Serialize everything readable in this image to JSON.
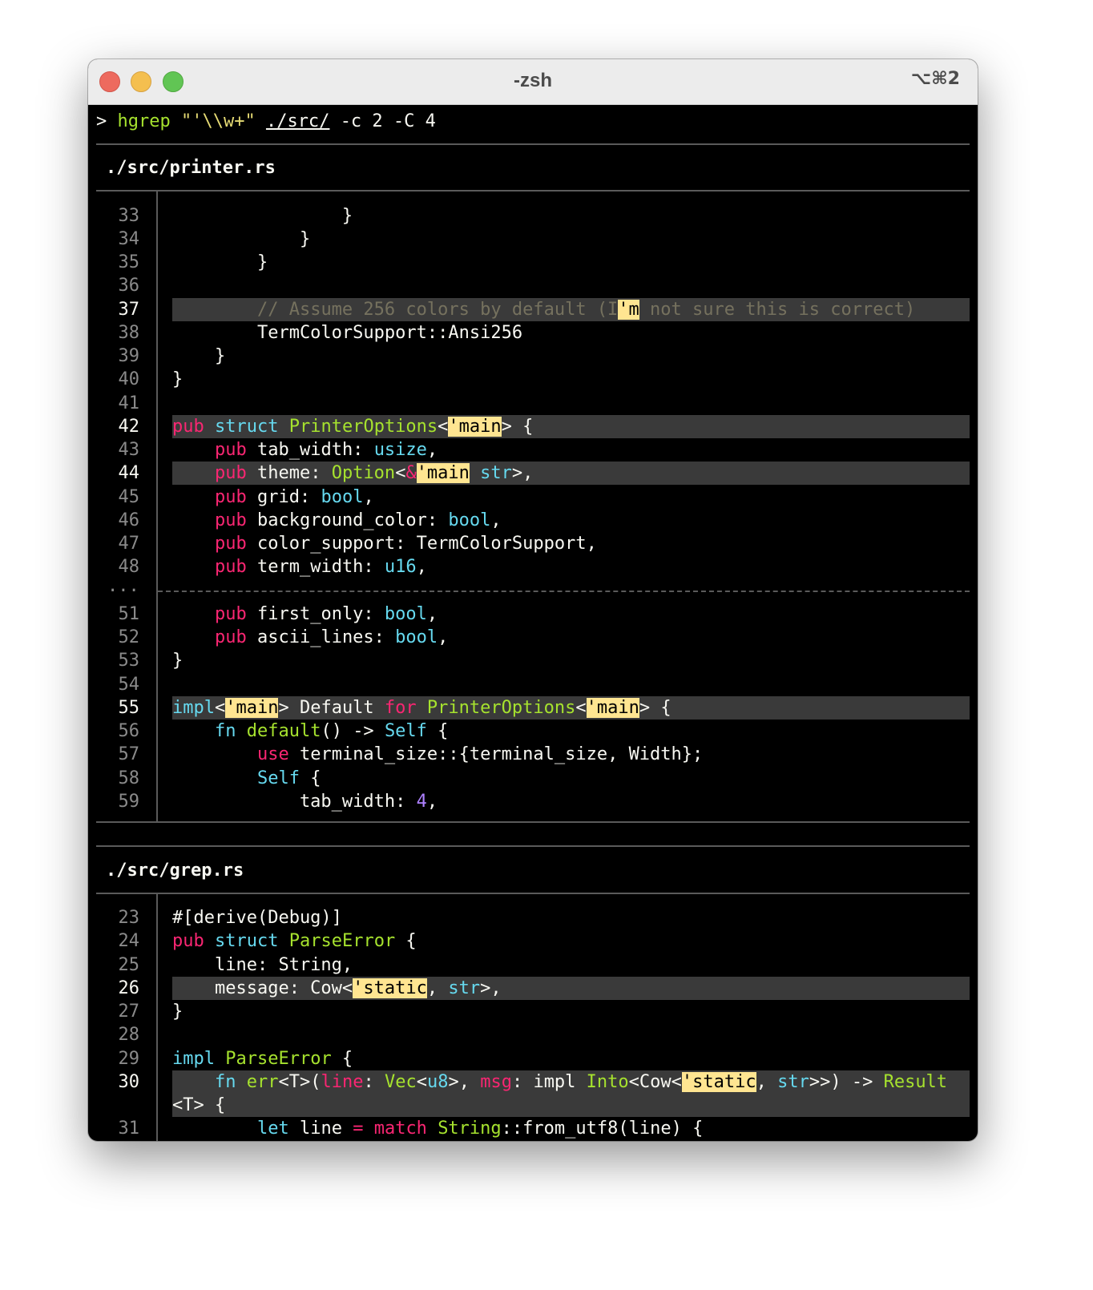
{
  "window": {
    "title": "-zsh",
    "shortcut": "⌥⌘2"
  },
  "command": {
    "prompt": ">",
    "program": "hgrep",
    "pattern": "\"'\\\\w+\"",
    "path": "./src/",
    "flags": "-c 2 -C 4"
  },
  "files": [
    {
      "name": "./src/printer.rs",
      "lines": [
        {
          "num": "33",
          "match": false,
          "tokens": [
            [
              "t",
              "                }"
            ]
          ]
        },
        {
          "num": "34",
          "match": false,
          "tokens": [
            [
              "t",
              "            }"
            ]
          ]
        },
        {
          "num": "35",
          "match": false,
          "tokens": [
            [
              "t",
              "        }"
            ]
          ]
        },
        {
          "num": "36",
          "match": false,
          "tokens": []
        },
        {
          "num": "37",
          "match": true,
          "tokens": [
            [
              "t",
              "        "
            ],
            [
              "cm",
              "// Assume 256 colors by default (I"
            ],
            [
              "mh",
              "'m"
            ],
            [
              "cm",
              " not sure this is correct)"
            ]
          ]
        },
        {
          "num": "38",
          "match": false,
          "tokens": [
            [
              "t",
              "        TermColorSupport::Ansi256"
            ]
          ]
        },
        {
          "num": "39",
          "match": false,
          "tokens": [
            [
              "t",
              "    }"
            ]
          ]
        },
        {
          "num": "40",
          "match": false,
          "tokens": [
            [
              "t",
              "}"
            ]
          ]
        },
        {
          "num": "41",
          "match": false,
          "tokens": []
        },
        {
          "num": "42",
          "match": true,
          "tokens": [
            [
              "kw",
              "pub"
            ],
            [
              "t",
              " "
            ],
            [
              "ty",
              "struct"
            ],
            [
              "t",
              " "
            ],
            [
              "fn",
              "PrinterOptions"
            ],
            [
              "t",
              "<"
            ],
            [
              "mh",
              "'main"
            ],
            [
              "t",
              "> {"
            ]
          ]
        },
        {
          "num": "43",
          "match": false,
          "tokens": [
            [
              "t",
              "    "
            ],
            [
              "kw",
              "pub"
            ],
            [
              "t",
              " tab_width: "
            ],
            [
              "ty",
              "usize"
            ],
            [
              "t",
              ","
            ]
          ]
        },
        {
          "num": "44",
          "match": true,
          "tokens": [
            [
              "t",
              "    "
            ],
            [
              "kw",
              "pub"
            ],
            [
              "t",
              " theme: "
            ],
            [
              "fn",
              "Option"
            ],
            [
              "t",
              "<"
            ],
            [
              "op",
              "&"
            ],
            [
              "mh",
              "'main"
            ],
            [
              "t",
              " "
            ],
            [
              "ty",
              "str"
            ],
            [
              "t",
              ">,"
            ]
          ]
        },
        {
          "num": "45",
          "match": false,
          "tokens": [
            [
              "t",
              "    "
            ],
            [
              "kw",
              "pub"
            ],
            [
              "t",
              " grid: "
            ],
            [
              "ty",
              "bool"
            ],
            [
              "t",
              ","
            ]
          ]
        },
        {
          "num": "46",
          "match": false,
          "tokens": [
            [
              "t",
              "    "
            ],
            [
              "kw",
              "pub"
            ],
            [
              "t",
              " background_color: "
            ],
            [
              "ty",
              "bool"
            ],
            [
              "t",
              ","
            ]
          ]
        },
        {
          "num": "47",
          "match": false,
          "tokens": [
            [
              "t",
              "    "
            ],
            [
              "kw",
              "pub"
            ],
            [
              "t",
              " color_support: TermColorSupport,"
            ]
          ]
        },
        {
          "num": "48",
          "match": false,
          "tokens": [
            [
              "t",
              "    "
            ],
            [
              "kw",
              "pub"
            ],
            [
              "t",
              " term_width: "
            ],
            [
              "ty",
              "u16"
            ],
            [
              "t",
              ","
            ]
          ]
        },
        {
          "elision": "..."
        },
        {
          "num": "51",
          "match": false,
          "tokens": [
            [
              "t",
              "    "
            ],
            [
              "kw",
              "pub"
            ],
            [
              "t",
              " first_only: "
            ],
            [
              "ty",
              "bool"
            ],
            [
              "t",
              ","
            ]
          ]
        },
        {
          "num": "52",
          "match": false,
          "tokens": [
            [
              "t",
              "    "
            ],
            [
              "kw",
              "pub"
            ],
            [
              "t",
              " ascii_lines: "
            ],
            [
              "ty",
              "bool"
            ],
            [
              "t",
              ","
            ]
          ]
        },
        {
          "num": "53",
          "match": false,
          "tokens": [
            [
              "t",
              "}"
            ]
          ]
        },
        {
          "num": "54",
          "match": false,
          "tokens": []
        },
        {
          "num": "55",
          "match": true,
          "tokens": [
            [
              "ty",
              "impl"
            ],
            [
              "t",
              "<"
            ],
            [
              "mh",
              "'main"
            ],
            [
              "t",
              "> Default "
            ],
            [
              "kw",
              "for"
            ],
            [
              "t",
              " "
            ],
            [
              "fn",
              "PrinterOptions"
            ],
            [
              "t",
              "<"
            ],
            [
              "mh",
              "'main"
            ],
            [
              "t",
              "> {"
            ]
          ]
        },
        {
          "num": "56",
          "match": false,
          "tokens": [
            [
              "t",
              "    "
            ],
            [
              "ty",
              "fn"
            ],
            [
              "t",
              " "
            ],
            [
              "fn",
              "default"
            ],
            [
              "t",
              "() -> "
            ],
            [
              "ty",
              "Self"
            ],
            [
              "t",
              " {"
            ]
          ]
        },
        {
          "num": "57",
          "match": false,
          "tokens": [
            [
              "t",
              "        "
            ],
            [
              "kw",
              "use"
            ],
            [
              "t",
              " terminal_size::{terminal_size, Width};"
            ]
          ]
        },
        {
          "num": "58",
          "match": false,
          "tokens": [
            [
              "t",
              "        "
            ],
            [
              "ty",
              "Self"
            ],
            [
              "t",
              " {"
            ]
          ]
        },
        {
          "num": "59",
          "match": false,
          "tokens": [
            [
              "t",
              "            tab_width: "
            ],
            [
              "num",
              "4"
            ],
            [
              "t",
              ","
            ]
          ]
        }
      ]
    },
    {
      "name": "./src/grep.rs",
      "lines": [
        {
          "num": "23",
          "match": false,
          "tokens": [
            [
              "t",
              "#[derive(Debug)]"
            ]
          ]
        },
        {
          "num": "24",
          "match": false,
          "tokens": [
            [
              "kw",
              "pub"
            ],
            [
              "t",
              " "
            ],
            [
              "ty",
              "struct"
            ],
            [
              "t",
              " "
            ],
            [
              "fn",
              "ParseError"
            ],
            [
              "t",
              " {"
            ]
          ]
        },
        {
          "num": "25",
          "match": false,
          "tokens": [
            [
              "t",
              "    line: String,"
            ]
          ]
        },
        {
          "num": "26",
          "match": true,
          "tokens": [
            [
              "t",
              "    message: Cow<"
            ],
            [
              "mh",
              "'static"
            ],
            [
              "t",
              ", "
            ],
            [
              "ty",
              "str"
            ],
            [
              "t",
              ">,"
            ]
          ]
        },
        {
          "num": "27",
          "match": false,
          "tokens": [
            [
              "t",
              "}"
            ]
          ]
        },
        {
          "num": "28",
          "match": false,
          "tokens": []
        },
        {
          "num": "29",
          "match": false,
          "tokens": [
            [
              "ty",
              "impl"
            ],
            [
              "t",
              " "
            ],
            [
              "fn",
              "ParseError"
            ],
            [
              "t",
              " {"
            ]
          ]
        },
        {
          "num": "30",
          "match": true,
          "tokens": [
            [
              "t",
              "    "
            ],
            [
              "ty",
              "fn"
            ],
            [
              "t",
              " "
            ],
            [
              "fn",
              "err"
            ],
            [
              "t",
              "<T>("
            ],
            [
              "kw",
              "line"
            ],
            [
              "t",
              ": "
            ],
            [
              "fn",
              "Vec"
            ],
            [
              "t",
              "<"
            ],
            [
              "ty",
              "u8"
            ],
            [
              "t",
              ">, "
            ],
            [
              "kw",
              "msg"
            ],
            [
              "t",
              ": impl "
            ],
            [
              "fn",
              "Into"
            ],
            [
              "t",
              "<Cow<"
            ],
            [
              "mh",
              "'static"
            ],
            [
              "t",
              ", "
            ],
            [
              "ty",
              "str"
            ],
            [
              "t",
              ">>) -> "
            ],
            [
              "fn",
              "Result"
            ]
          ]
        },
        {
          "num": "",
          "match": true,
          "tokens": [
            [
              "t",
              "<T> {"
            ]
          ]
        },
        {
          "num": "31",
          "match": false,
          "tokens": [
            [
              "t",
              "        "
            ],
            [
              "ty",
              "let"
            ],
            [
              "t",
              " line "
            ],
            [
              "op",
              "="
            ],
            [
              "t",
              " "
            ],
            [
              "kw",
              "match"
            ],
            [
              "t",
              " "
            ],
            [
              "fn",
              "String"
            ],
            [
              "t",
              "::from_utf8(line) {"
            ]
          ]
        }
      ]
    }
  ]
}
